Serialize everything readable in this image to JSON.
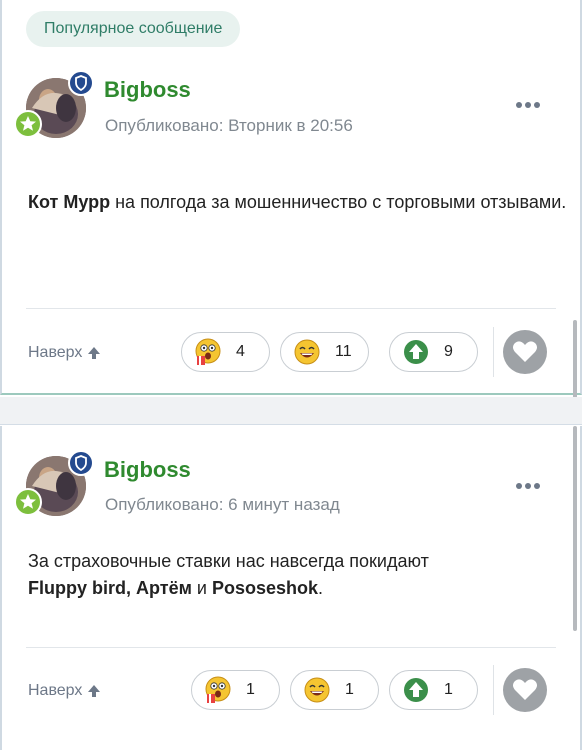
{
  "badge": "Популярное сообщение",
  "posts": [
    {
      "author": "Bigboss",
      "meta": "Опубликовано: Вторник в 20:56",
      "text_parts": [
        "Кот Мурр",
        " на полгода за мошенничество с торговыми отзывами."
      ],
      "up_label": "Наверх",
      "reactions": [
        {
          "icon": "shocked-popcorn-emoji",
          "count": "4"
        },
        {
          "icon": "laughing-emoji",
          "count": "11"
        },
        {
          "icon": "upvote-arrow",
          "count": "9"
        }
      ]
    },
    {
      "author": "Bigboss",
      "meta": "Опубликовано: 6 минут назад",
      "text_parts": [
        "За страховочные ставки нас навсегда покидают ",
        "Fluppy bird, Артём",
        " и ",
        "Pososeshok",
        "."
      ],
      "up_label": "Наверх",
      "reactions": [
        {
          "icon": "shocked-popcorn-emoji",
          "count": "1"
        },
        {
          "icon": "laughing-emoji",
          "count": "1"
        },
        {
          "icon": "upvote-arrow",
          "count": "1"
        }
      ]
    }
  ],
  "colors": {
    "accent_green": "#2f8a2f",
    "badge_bg": "#e8f2ef",
    "mod_badge": "#244a8f"
  }
}
